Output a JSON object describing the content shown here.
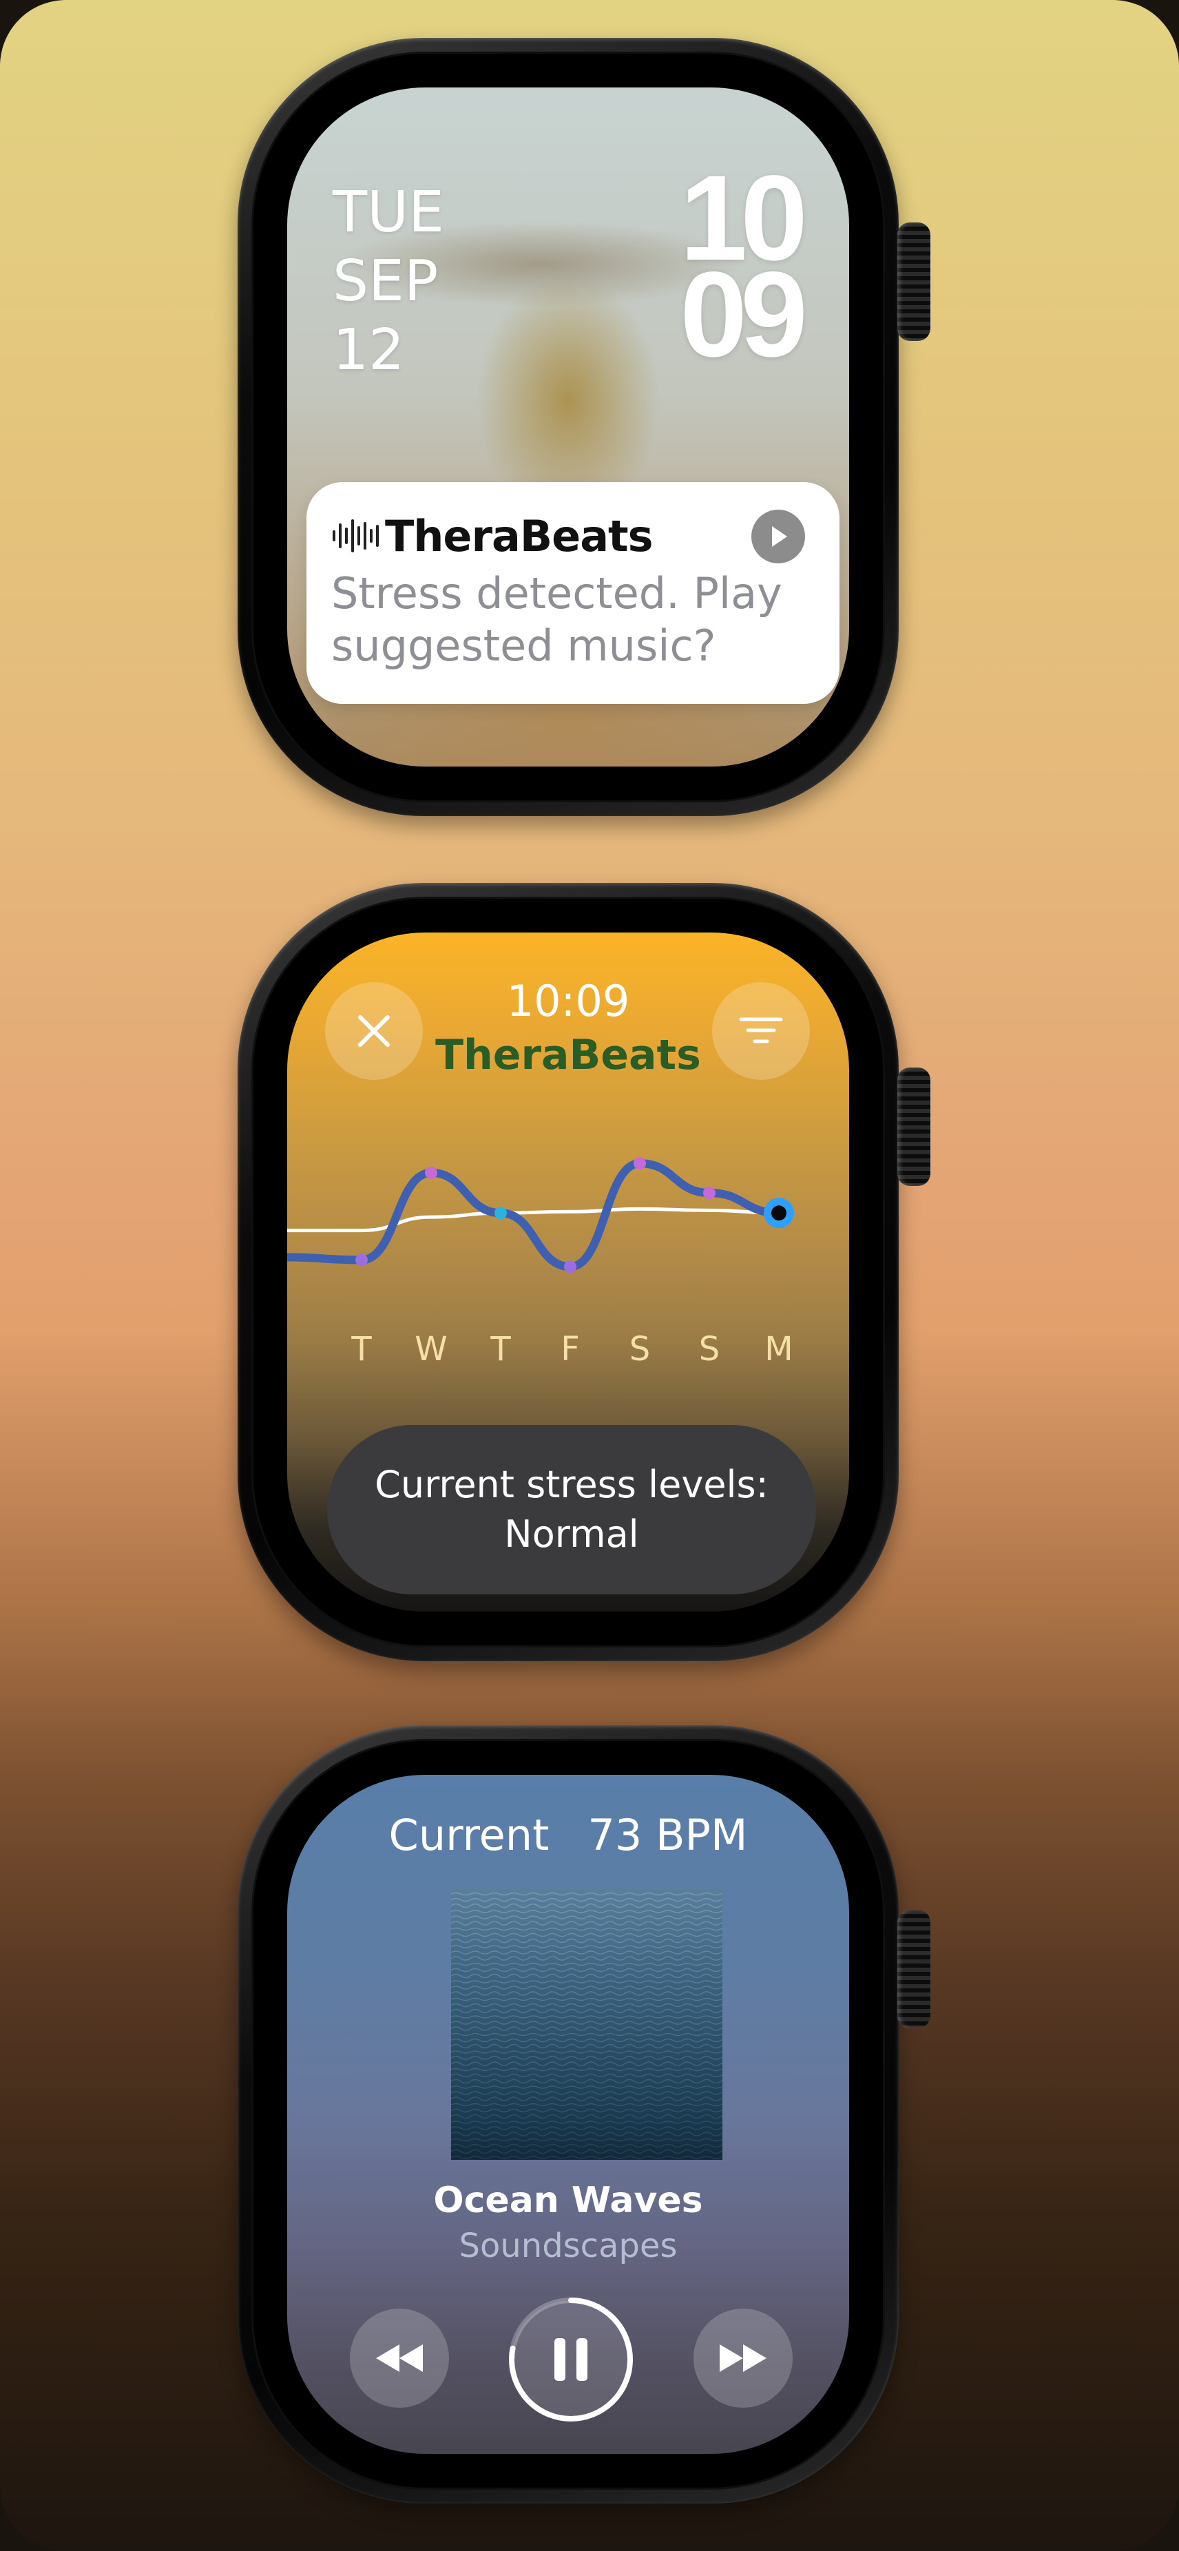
{
  "notification_screen": {
    "date": {
      "weekday": "TUE",
      "month": "SEP",
      "day": "12"
    },
    "time": {
      "hours": "10",
      "minutes": "09"
    },
    "notification": {
      "app_name": "TheraBeats",
      "message": "Stress detected. Play suggested music?",
      "action_icon": "play-icon"
    }
  },
  "stress_screen": {
    "time": "10:09",
    "app_name": "TheraBeats",
    "close_icon": "close-icon",
    "menu_icon": "menu-icon",
    "days": [
      "T",
      "W",
      "T",
      "F",
      "S",
      "S",
      "M"
    ],
    "stress_trend": [
      0.1,
      0.75,
      0.45,
      0.05,
      0.82,
      0.6,
      0.45
    ],
    "baseline_trend": [
      0.32,
      0.42,
      0.45,
      0.46,
      0.48,
      0.47,
      0.45
    ],
    "point_colors": [
      "#9a6ee0",
      "#c46ad9",
      "#2bb3e0",
      "#9a6ee0",
      "#c46ad9",
      "#c46ad9",
      "#2ea0ff"
    ],
    "status_line1": "Current stress levels:",
    "status_line2": "Normal"
  },
  "player_screen": {
    "current_label": "Current",
    "bpm_label": "73 BPM",
    "track_title": "Ocean Waves",
    "track_subtitle": "Soundscapes",
    "controls": {
      "previous_icon": "rewind-icon",
      "pause_icon": "pause-icon",
      "next_icon": "fast-forward-icon"
    },
    "playback_progress": 0.78
  },
  "colors": {
    "app_name_green": "#2a5c23",
    "pill_background": "#3b3b3d",
    "stress_line": "#3f5fb0",
    "baseline_line": "#ffffff"
  }
}
